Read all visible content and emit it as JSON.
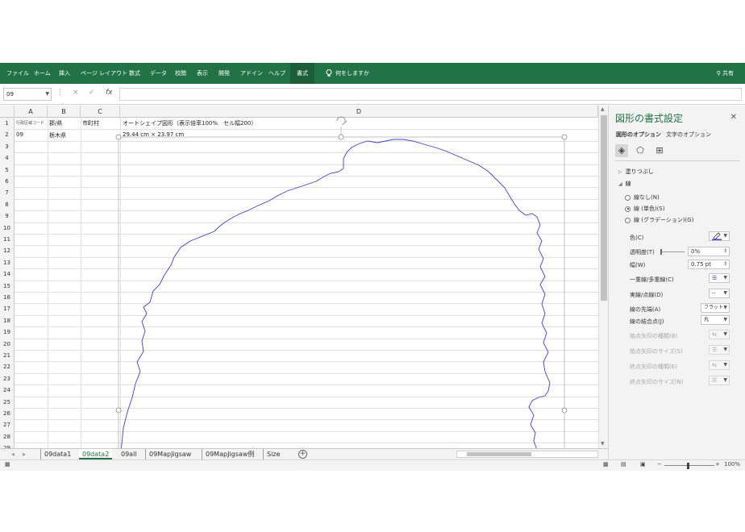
{
  "ribbon": {
    "tabs": [
      "ファイル",
      "ホーム",
      "挿入",
      "ページ レイアウト",
      "数式",
      "データ",
      "校閲",
      "表示",
      "開発",
      "アドイン",
      "ヘルプ",
      "書式"
    ],
    "active_tab": "書式",
    "tell_me": "何をしますか",
    "share": "共有",
    "accent_color": "#217346"
  },
  "formula_bar": {
    "name_box": "09",
    "cancel_icon": "×",
    "enter_icon": "✓",
    "fx_label": "fx",
    "formula": ""
  },
  "sheet": {
    "columns": [
      "A",
      "B",
      "C",
      "D"
    ],
    "rows": [
      "1",
      "2",
      "3",
      "4",
      "5",
      "6",
      "7",
      "8",
      "9",
      "10",
      "11",
      "12",
      "13",
      "14",
      "15",
      "16",
      "17",
      "18",
      "19",
      "20",
      "21",
      "22",
      "23",
      "24",
      "25",
      "26",
      "27",
      "28",
      "29"
    ],
    "cells": {
      "A1": "行政区域コード",
      "B1": "郡/県",
      "C1": "市町村",
      "D1": "オートシェイプ図形（表示倍率100%　セル幅200）",
      "A2": "09",
      "B2": "栃木県",
      "D2": "29.44 cm × 23.97 cm"
    },
    "shape": {
      "name": "09",
      "outline_color": "#3b3bff",
      "handle_color": "#888888"
    }
  },
  "sheet_tabs": {
    "tabs": [
      "09data1",
      "09data2",
      "09all",
      "09MapJigsaw",
      "09MapJigsaw例",
      "Size"
    ],
    "active": "09data2",
    "add_label": "+"
  },
  "status_bar": {
    "zoom": "100%"
  },
  "pane": {
    "title": "図形の書式設定",
    "tabs": [
      "図形のオプション",
      "文字のオプション"
    ],
    "active_tab": "図形のオプション",
    "sections": {
      "fill": "塗りつぶし",
      "line": "線"
    },
    "line_options": [
      "線なし(N)",
      "線 (単色)(S)",
      "線 (グラデーション)(G)"
    ],
    "selected_line_option": "線 (単色)(S)",
    "props": {
      "color": "色(C)",
      "transparency": "透明度(T)",
      "transparency_value": "0%",
      "width": "幅(W)",
      "width_value": "0.75 pt",
      "compound": "一重線/多重線(C)",
      "dash": "実線/点線(D)",
      "cap": "線の先端(A)",
      "cap_value": "フラット",
      "join": "線の結合点(J)",
      "join_value": "丸",
      "begin_arrow_type": "始点矢印の種類(B)",
      "begin_arrow_size": "始点矢印のサイズ(S)",
      "end_arrow_type": "終点矢印の種類(E)",
      "end_arrow_size": "終点矢印のサイズ(N)"
    }
  }
}
